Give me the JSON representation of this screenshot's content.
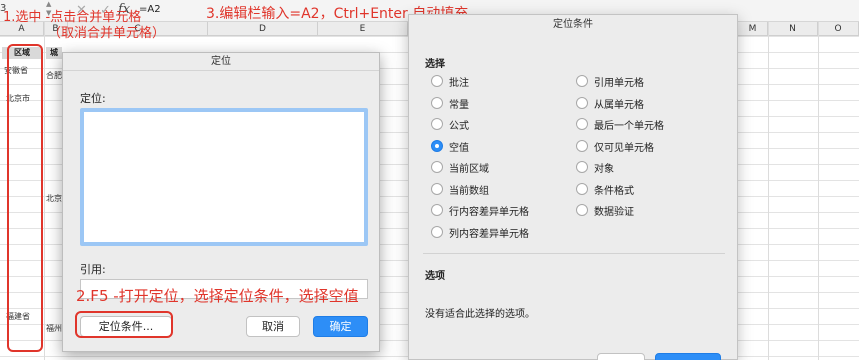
{
  "formula_bar": {
    "cell_ref": "3",
    "fx": "fx",
    "formula": "=A2",
    "cancel_glyph": "✕",
    "confirm_glyph": "✓"
  },
  "columns": {
    "A": "A",
    "B": "B",
    "C": "C",
    "D": "D",
    "E": "E",
    "M": "M",
    "N": "N",
    "O": "O"
  },
  "sheet": {
    "header_region": "区域",
    "header_city": "城",
    "row_anhui": "安徽省",
    "row_hefei": "合肥",
    "row_beijing": "北京市",
    "row_beijing_city": "北京",
    "row_fujian": "福建省",
    "row_fuzhou": "福州"
  },
  "annotations": {
    "step1_line1": "1.选中 -点击合并单元格",
    "step1_line2": "（取消合并单元格）",
    "step2": "2.F5 -打开定位，选择定位条件，选择空值",
    "step3": "3.编辑栏输入=A2，Ctrl+Enter 自动填充"
  },
  "locate_dialog": {
    "title": "定位",
    "goto_label": "定位:",
    "reference_label": "引用:",
    "special_button": "定位条件...",
    "cancel_button": "取消",
    "ok_button": "确定"
  },
  "locate_condition_dialog": {
    "title": "定位条件",
    "select_label": "选择",
    "options_left": [
      "批注",
      "常量",
      "公式",
      "空值",
      "当前区域",
      "当前数组",
      "行内容差异单元格",
      "列内容差异单元格"
    ],
    "options_right": [
      "引用单元格",
      "从属单元格",
      "最后一个单元格",
      "仅可见单元格",
      "对象",
      "条件格式",
      "数据验证"
    ],
    "selected_option": "空值",
    "options_section_label": "选项",
    "no_options_text": "没有适合此选择的选项。"
  },
  "colors": {
    "annotation_red": "#e0352b",
    "accent_blue": "#2d8ef7"
  }
}
